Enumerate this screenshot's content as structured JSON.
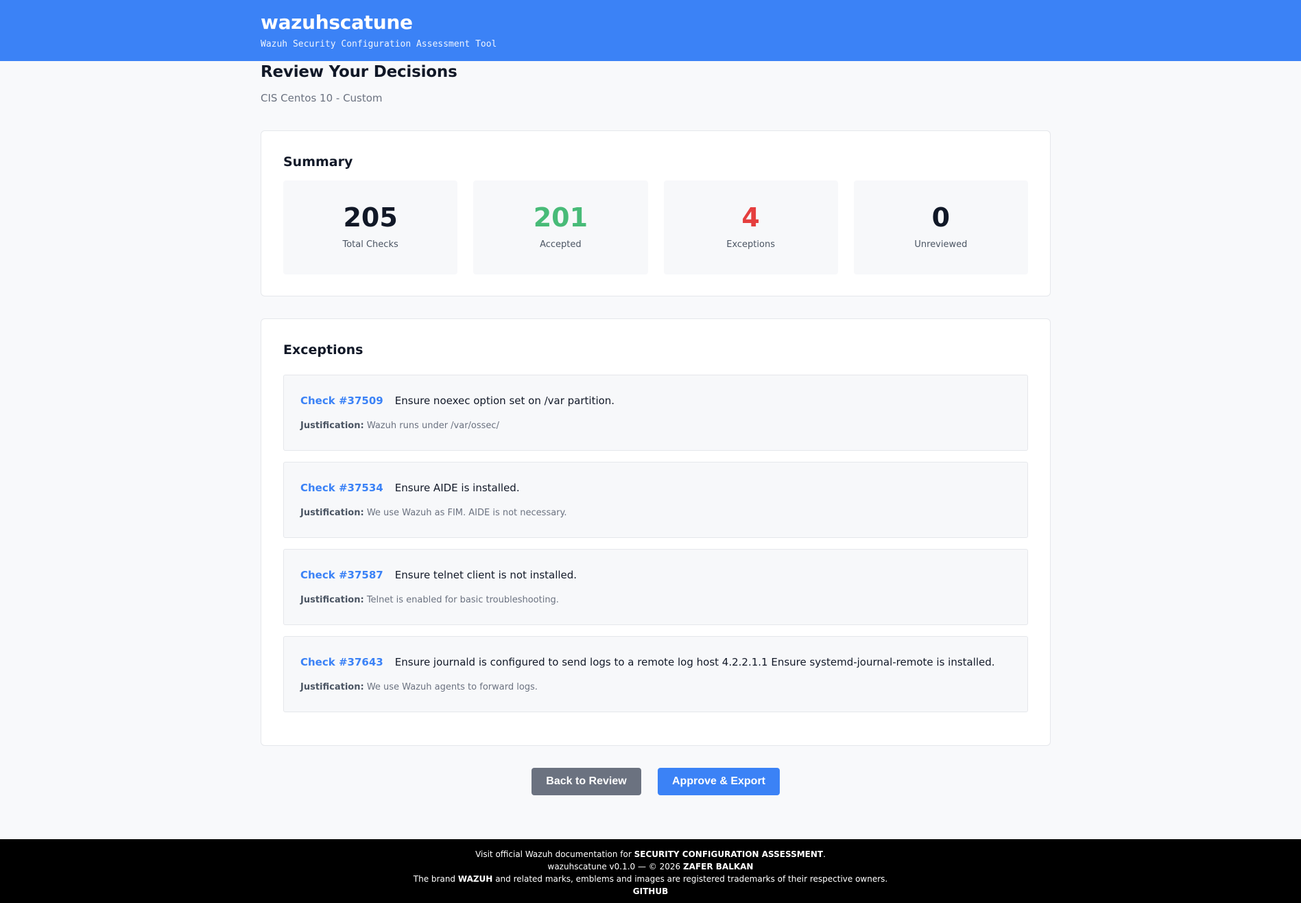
{
  "header": {
    "title": "wazuhscatune",
    "subtitle": "Wazuh Security Configuration Assessment Tool"
  },
  "page": {
    "title": "Review Your Decisions",
    "subtitle": "CIS Centos 10 - Custom"
  },
  "summary": {
    "heading": "Summary",
    "stats": [
      {
        "value": "205",
        "label": "Total Checks",
        "color": "#111827"
      },
      {
        "value": "201",
        "label": "Accepted",
        "color": "#48bb78"
      },
      {
        "value": "4",
        "label": "Exceptions",
        "color": "#e53e3e"
      },
      {
        "value": "0",
        "label": "Unreviewed",
        "color": "#111827"
      }
    ]
  },
  "exceptions": {
    "heading": "Exceptions",
    "justification_label": "Justification:",
    "items": [
      {
        "id": "Check #37509",
        "title": "Ensure noexec option set on /var partition.",
        "justification": "Wazuh runs under /var/ossec/"
      },
      {
        "id": "Check #37534",
        "title": "Ensure AIDE is installed.",
        "justification": "We use Wazuh as FIM. AIDE is not necessary."
      },
      {
        "id": "Check #37587",
        "title": "Ensure telnet client is not installed.",
        "justification": "Telnet is enabled for basic troubleshooting."
      },
      {
        "id": "Check #37643",
        "title": "Ensure journald is configured to send logs to a remote log host 4.2.2.1.1 Ensure systemd-journal-remote is installed.",
        "justification": "We use Wazuh agents to forward logs."
      }
    ]
  },
  "actions": {
    "back_label": "Back to Review",
    "approve_label": "Approve & Export"
  },
  "footer": {
    "line1_prefix": "Visit official Wazuh documentation for",
    "line1_link": "SECURITY CONFIGURATION ASSESSMENT",
    "line1_suffix": ".",
    "line2_prefix": "wazuhscatune v0.1.0 — © 2026",
    "line2_author": "ZAFER BALKAN",
    "line3_prefix": "The brand",
    "line3_brand": "WAZUH",
    "line3_suffix": "and related marks, emblems and images are registered trademarks of their respective owners.",
    "github": "GITHUB"
  }
}
